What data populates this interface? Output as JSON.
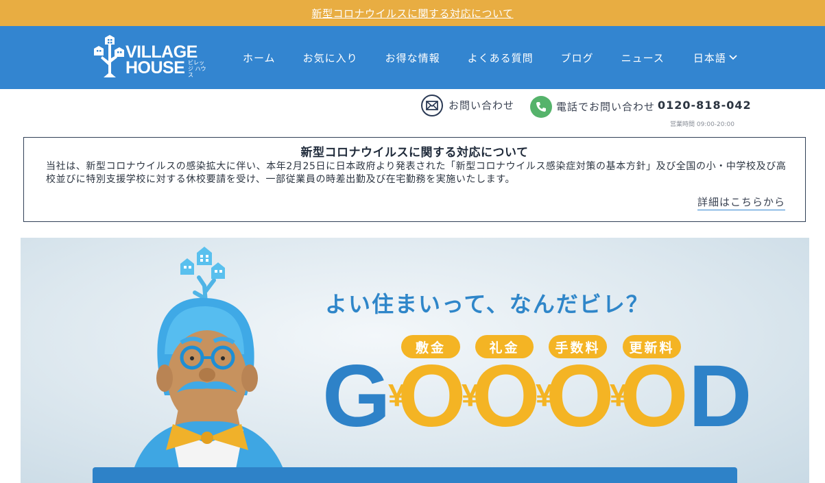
{
  "topbar": {
    "notice_link": "新型コロナウイルスに関する対応について"
  },
  "header": {
    "logo": {
      "line1": "VILLAGE",
      "line2": "HOUSE",
      "kana": "ビレッジ ハウス"
    },
    "nav": [
      "ホーム",
      "お気に入り",
      "お得な情報",
      "よくある質問",
      "ブログ",
      "ニュース"
    ],
    "language": "日本語"
  },
  "contact": {
    "mail_label": "お問い合わせ",
    "phone_label": "電話でお問い合わせ",
    "phone_number": "0120-818-042",
    "hours": "営業時間 09:00-20:00"
  },
  "notice": {
    "title": "新型コロナウイルスに関する対応について",
    "body": "当社は、新型コロナウイルスの感染拡大に伴い、本年2月25日に日本政府より発表された「新型コロナウイルス感染症対策の基本方針」及び全国の小・中学校及び高校並びに特別支援学校に対する休校要請を受け、一部従業員の時差出勤及び在宅勤務を実施いたします。",
    "details_link": "詳細はこちらから"
  },
  "hero": {
    "tagline": "よい住まいって、なんだビレ？",
    "fees": [
      "敷金",
      "礼金",
      "手数料",
      "更新料"
    ],
    "word_letters": [
      "G",
      "O",
      "O",
      "O",
      "O",
      "D"
    ],
    "currency_symbol": "¥"
  },
  "colors": {
    "topbar": "#e8ad42",
    "header": "#3385d0",
    "accent_gold": "#f4b424",
    "accent_blue": "#2e82c8",
    "phone_green": "#55b36b"
  },
  "icons": [
    "mail-icon",
    "phone-icon",
    "chevron-down-icon",
    "tree-house-logo-icon"
  ]
}
